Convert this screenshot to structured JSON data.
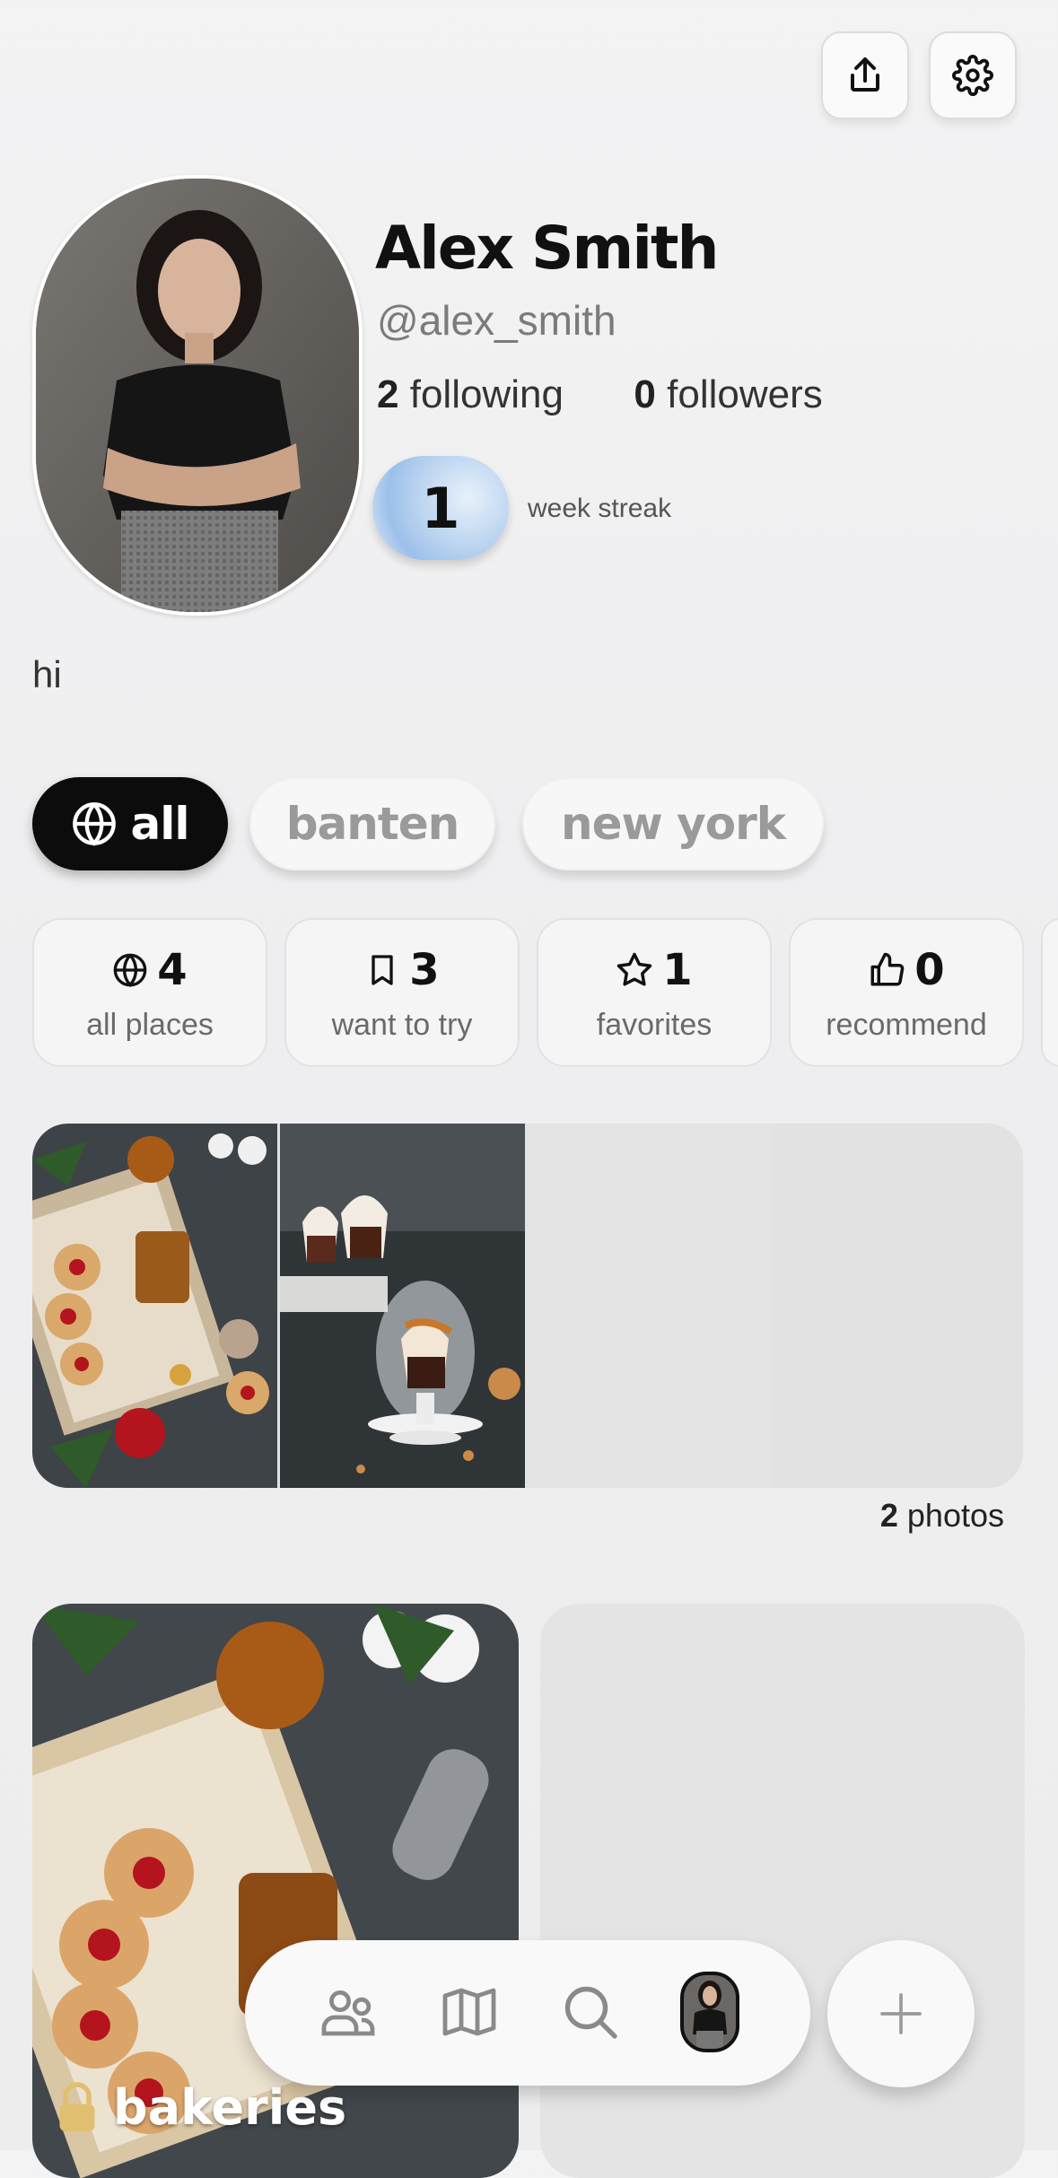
{
  "header": {
    "share_icon": "share-icon",
    "settings_icon": "gear-icon"
  },
  "profile": {
    "name": "Alex Smith",
    "handle": "@alex_smith",
    "following_count": "2",
    "following_label": "following",
    "followers_count": "0",
    "followers_label": "followers",
    "streak_value": "1",
    "streak_label": "week streak",
    "bio": "hi"
  },
  "filters": [
    {
      "label": "all",
      "icon": "globe-icon",
      "active": true
    },
    {
      "label": "banten",
      "active": false
    },
    {
      "label": "new york",
      "active": false
    }
  ],
  "stats": [
    {
      "icon": "globe-icon",
      "value": "4",
      "label": "all places"
    },
    {
      "icon": "bookmark-icon",
      "value": "3",
      "label": "want to try"
    },
    {
      "icon": "star-icon",
      "value": "1",
      "label": "favorites"
    },
    {
      "icon": "thumbs-up-icon",
      "value": "0",
      "label": "recommend"
    }
  ],
  "photos": {
    "count": "2",
    "label": "photos"
  },
  "lists": [
    {
      "title": "bakeries",
      "icon": "lock-icon"
    }
  ],
  "nav": {
    "items": [
      "friends-icon",
      "map-icon",
      "search-icon",
      "profile-avatar"
    ],
    "add_icon": "plus-icon"
  },
  "colors": {
    "active_pill": "#0c0c0c",
    "background": "#efeff0",
    "streak_blue": "#b9d3ef"
  }
}
